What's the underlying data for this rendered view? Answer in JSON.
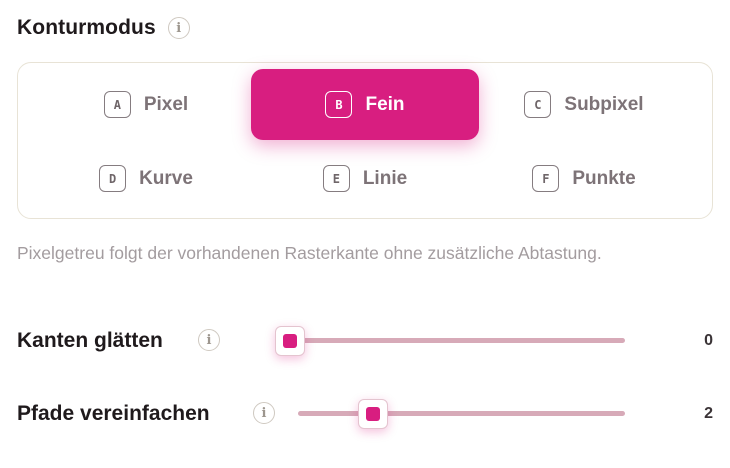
{
  "section": {
    "title": "Konturmodus",
    "info_glyph": "i"
  },
  "modes": [
    {
      "key": "A",
      "label": "Pixel",
      "active": false
    },
    {
      "key": "B",
      "label": "Fein",
      "active": true
    },
    {
      "key": "C",
      "label": "Subpixel",
      "active": false
    },
    {
      "key": "D",
      "label": "Kurve",
      "active": false
    },
    {
      "key": "E",
      "label": "Linie",
      "active": false
    },
    {
      "key": "F",
      "label": "Punkte",
      "active": false
    }
  ],
  "description": "Pixelgetreu folgt der vorhandenen Rasterkante ohne zusätzliche Abtastung.",
  "sliders": {
    "smooth": {
      "label": "Kanten glätten",
      "value": "0",
      "info_glyph": "i"
    },
    "simplify": {
      "label": "Pfade vereinfachen",
      "value": "2",
      "info_glyph": "i"
    }
  },
  "colors": {
    "accent": "#d81e80",
    "track": "#d7aab8",
    "panel_border": "#e8e3d6"
  }
}
